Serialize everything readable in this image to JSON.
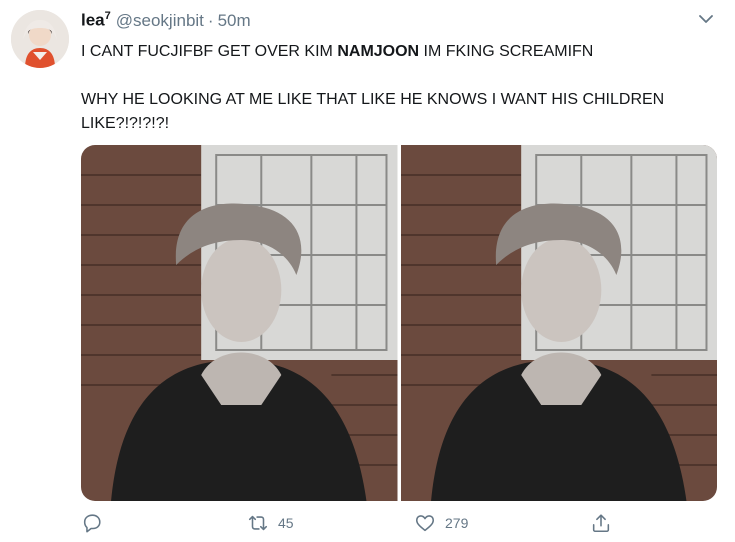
{
  "tweet": {
    "display_name": "lea",
    "display_name_sup": "7",
    "handle": "@seokjinbit",
    "separator": "·",
    "timestamp": "50m",
    "text": {
      "line1_before": "I CANT FUCJIFBF GET OVER KIM ",
      "line1_bold": "NAMJOON",
      "line1_after": " IM FKING SCREAMIFN",
      "line2": "WHY HE LOOKING AT ME LIKE THAT LIKE HE KNOWS I WANT HIS CHILDREN LIKE?!?!?!?!"
    }
  },
  "actions": {
    "reply_count": "",
    "retweet_count": "45",
    "like_count": "279"
  },
  "colors": {
    "text": "#14171a",
    "muted": "#657786"
  },
  "icons": [
    "avatar",
    "chevron-down-icon",
    "reply-icon",
    "retweet-icon",
    "like-icon",
    "share-icon"
  ]
}
